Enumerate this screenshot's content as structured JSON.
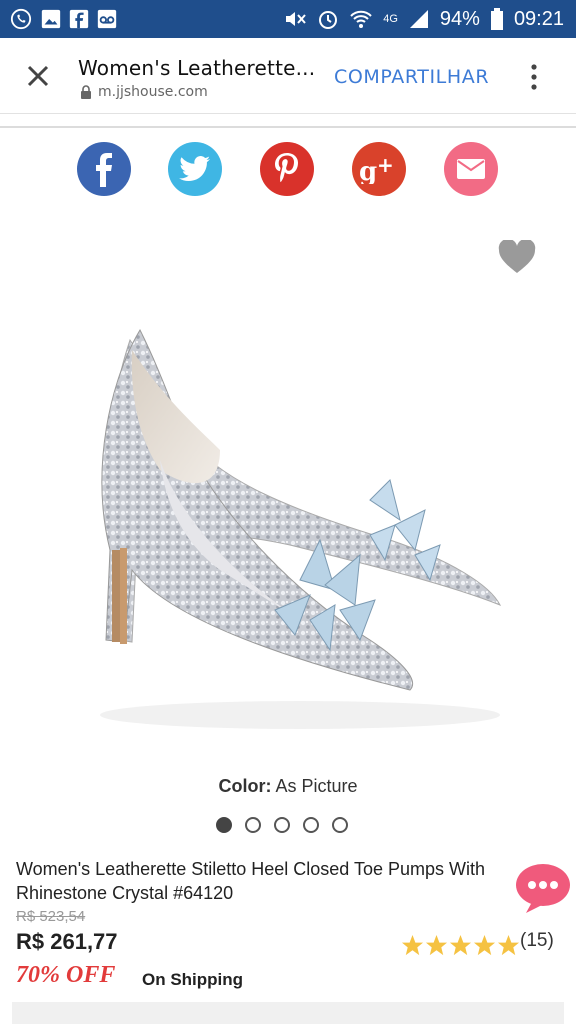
{
  "statusbar": {
    "battery": "94%",
    "time": "09:21",
    "network": "4G",
    "left_icons": [
      "whatsapp-icon",
      "image-icon",
      "facebook-icon",
      "voicemail-icon"
    ],
    "right_icons": [
      "mute-icon",
      "alarm-icon",
      "wifi-icon",
      "signal-icon",
      "battery-icon"
    ]
  },
  "appbar": {
    "title": "Women's Leatherette...",
    "url": "m.jjshouse.com",
    "share_label": "COMPARTILHAR"
  },
  "social": [
    {
      "name": "facebook",
      "color": "#3b65b2"
    },
    {
      "name": "twitter",
      "color": "#3fb6e4"
    },
    {
      "name": "pinterest",
      "color": "#d9322b"
    },
    {
      "name": "google-plus",
      "color": "#d9422b"
    },
    {
      "name": "email",
      "color": "#f26b85"
    }
  ],
  "product": {
    "color_label": "Color:",
    "color_value": "As Picture",
    "image_count": 5,
    "active_image": 1,
    "name": "Women's Leatherette Stiletto Heel Closed Toe Pumps With\nRhinestone Crystal #64120",
    "old_price": "R$ 523,54",
    "price": "R$ 261,77",
    "rating_stars": 5,
    "rating_count": "(15)",
    "discount": "70% OFF",
    "shipping": "On Shipping"
  },
  "colors": {
    "statusbar": "#1f4e8c",
    "accent": "#3d7bd6",
    "discount": "#e23b3b",
    "star": "#f5c242"
  }
}
